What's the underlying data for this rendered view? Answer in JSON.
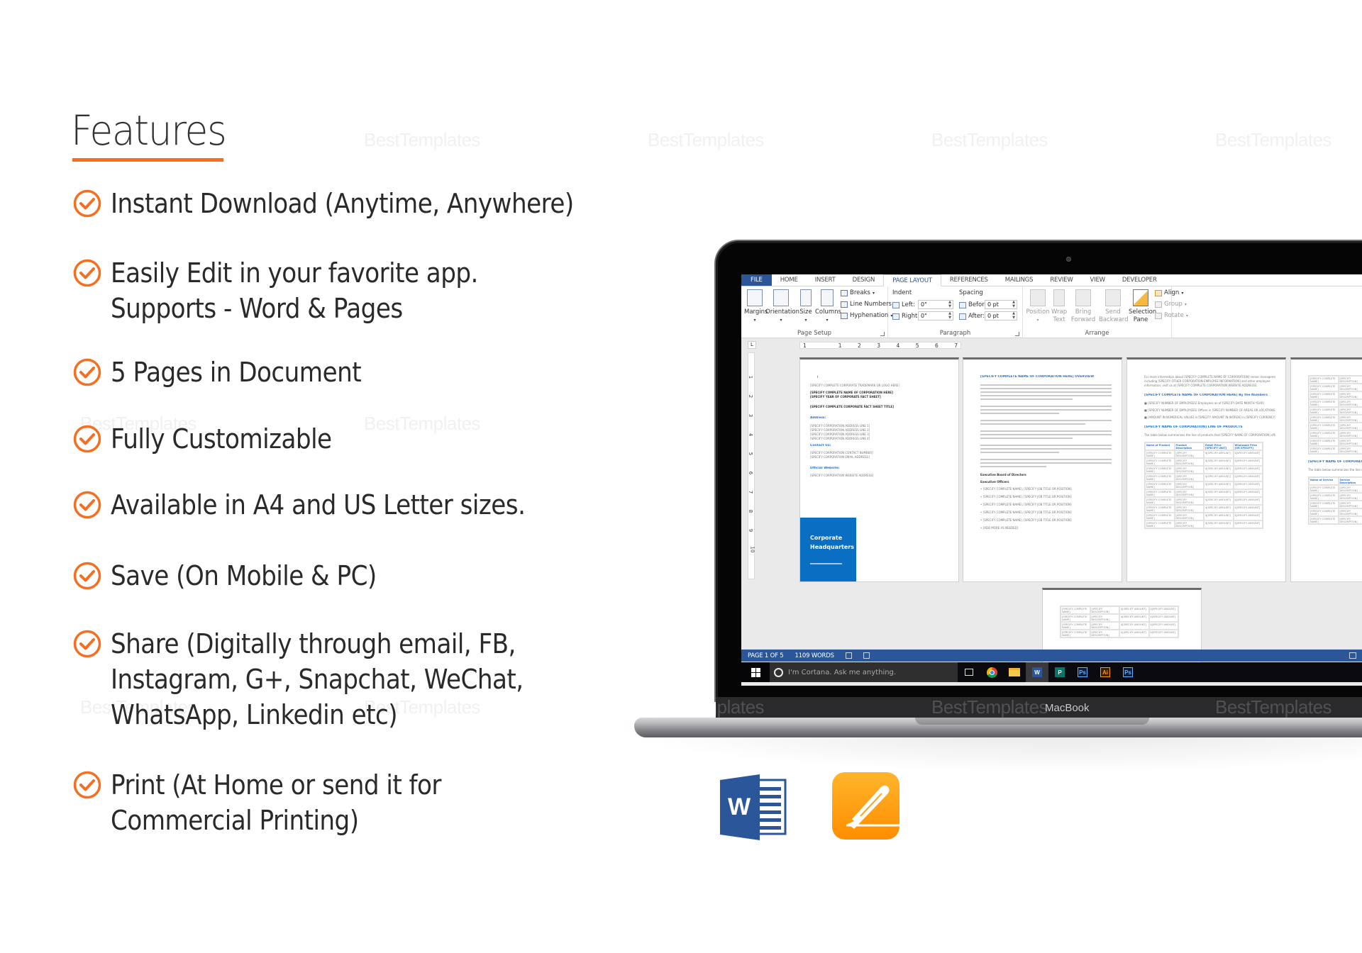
{
  "features": {
    "title": "Features",
    "items": [
      {
        "lines": [
          "Instant Download (Anytime, Anywhere)"
        ]
      },
      {
        "lines": [
          "Easily Edit in your favorite app.",
          "Supports - Word & Pages"
        ]
      },
      {
        "lines": [
          "5 Pages in Document"
        ]
      },
      {
        "lines": [
          "Fully Customizable"
        ]
      },
      {
        "lines": [
          "Available in A4 and US Letter sizes."
        ]
      },
      {
        "lines": [
          "Save (On Mobile & PC)"
        ]
      },
      {
        "lines": [
          "Share (Digitally through email, FB,",
          "Instagram, G+, Snapchat, WeChat,",
          "WhatsApp, Linkedin etc)"
        ]
      },
      {
        "lines": [
          "Print (At Home or send it for",
          "Commercial Printing)"
        ]
      }
    ],
    "icon": "check-circle-icon",
    "accent_color": "#f36f21"
  },
  "watermark": "BestTemplates",
  "laptop": {
    "brand_label": "MacBook",
    "word": {
      "tabs": [
        "FILE",
        "HOME",
        "INSERT",
        "DESIGN",
        "PAGE LAYOUT",
        "REFERENCES",
        "MAILINGS",
        "REVIEW",
        "VIEW",
        "DEVELOPER"
      ],
      "active_tab": "PAGE LAYOUT",
      "ribbon": {
        "page_setup": {
          "label": "Page Setup",
          "margins": "Margins",
          "orientation": "Orientation",
          "size": "Size",
          "columns": "Columns",
          "breaks": "Breaks",
          "line_numbers": "Line Numbers",
          "hyphenation": "Hyphenation"
        },
        "paragraph": {
          "label": "Paragraph",
          "indent_label": "Indent",
          "spacing_label": "Spacing",
          "left_label": "Left:",
          "right_label": "Right:",
          "before_label": "Before:",
          "after_label": "After:",
          "left_value": "0\"",
          "right_value": "0\"",
          "before_value": "0 pt",
          "after_value": "0 pt"
        },
        "arrange": {
          "label": "Arrange",
          "position": "Position",
          "wrap_text": "Wrap Text",
          "bring_forward": "Bring Forward",
          "send_backward": "Send Backward",
          "selection_pane": "Selection Pane",
          "align": "Align",
          "group": "Group",
          "rotate": "Rotate"
        }
      },
      "ruler_ticks": [
        "1",
        "",
        "1",
        "2",
        "3",
        "4",
        "5",
        "6",
        "7"
      ],
      "vruler_ticks": [
        "1",
        "2",
        "3",
        "4",
        "5",
        "6",
        "7",
        "8",
        "9",
        "10"
      ],
      "page1": {
        "lines": [
          "[SPECIFY COMPLETE CORPORATE TRADEMARK OR LOGO HERE]",
          "[SPECIFY COMPLETE NAME OF CORPORATION HERE]",
          "[SPECIFY YEAR OF CORPORATE FACT SHEET]",
          "[SPECIFY COMPLETE CORPORATE FACT SHEET TITLE]"
        ],
        "address_heading": "Address:",
        "address_lines": [
          "[SPECIFY CORPORATION ADDRESS LINE 1]",
          "[SPECIFY CORPORATION ADDRESS LINE 2]",
          "[SPECIFY CORPORATION ADDRESS LINE 3]",
          "[SPECIFY CORPORATION ADDRESS LINE 4]"
        ],
        "contact_heading": "Contact Us:",
        "contact_lines": [
          "[SPECIFY CORPORATION CONTACT NUMBER]",
          "[SPECIFY CORPORATION EMAIL ADDRESS]"
        ],
        "website_heading": "Official Website:",
        "website_line": "[SPECIFY CORPORATION WEBSITE ADDRESS]",
        "hq_line1": "Corporate",
        "hq_line2": "Headquarters"
      },
      "page2": {
        "heading": "[SPECIFY COMPLETE NAME OF CORPORATION HERE] OVERVIEW",
        "board_heading": "Executive Board of Directors",
        "officers_heading": "Executive Officers",
        "bullets": [
          "[SPECIFY COMPLETE NAME], [SPECIFY JOB TITLE OR POSITION]",
          "[SPECIFY COMPLETE NAME], [SPECIFY JOB TITLE OR POSITION]",
          "[SPECIFY COMPLETE NAME], [SPECIFY JOB TITLE OR POSITION]",
          "[SPECIFY COMPLETE NAME], [SPECIFY JOB TITLE OR POSITION]",
          "[SPECIFY COMPLETE NAME], [SPECIFY JOB TITLE OR POSITION]",
          "[ADD MORE AS NEEDED]"
        ]
      },
      "page3": {
        "heading": "[SPECIFY COMPLETE NAME OF CORPORATION HERE] By the Numbers",
        "products_heading": "[SPECIFY NAME OF CORPORATION] LINE OF PRODUCTS",
        "table_headers": [
          "Name of Product",
          "Product Description",
          "Retail Price [SPECIFY UNIT]",
          "Wholesale Price [OR SPECIFY]"
        ]
      },
      "page4": {
        "services_heading": "[SPECIFY NAME OF CORPORATION] LINE OF SERVICES",
        "table_headers": [
          "Name of Service",
          "Service Description"
        ]
      },
      "status": {
        "page": "PAGE 1 OF 5",
        "words": "1109 WORDS"
      },
      "taskbar": {
        "cortana_placeholder": "I'm Cortana. Ask me anything.",
        "apps": [
          "task-view",
          "chrome",
          "file-explorer",
          "word",
          "publisher",
          "photoshop",
          "illustrator",
          "photoshop"
        ]
      }
    }
  },
  "app_icons": [
    "microsoft-word-icon",
    "apple-pages-icon"
  ]
}
